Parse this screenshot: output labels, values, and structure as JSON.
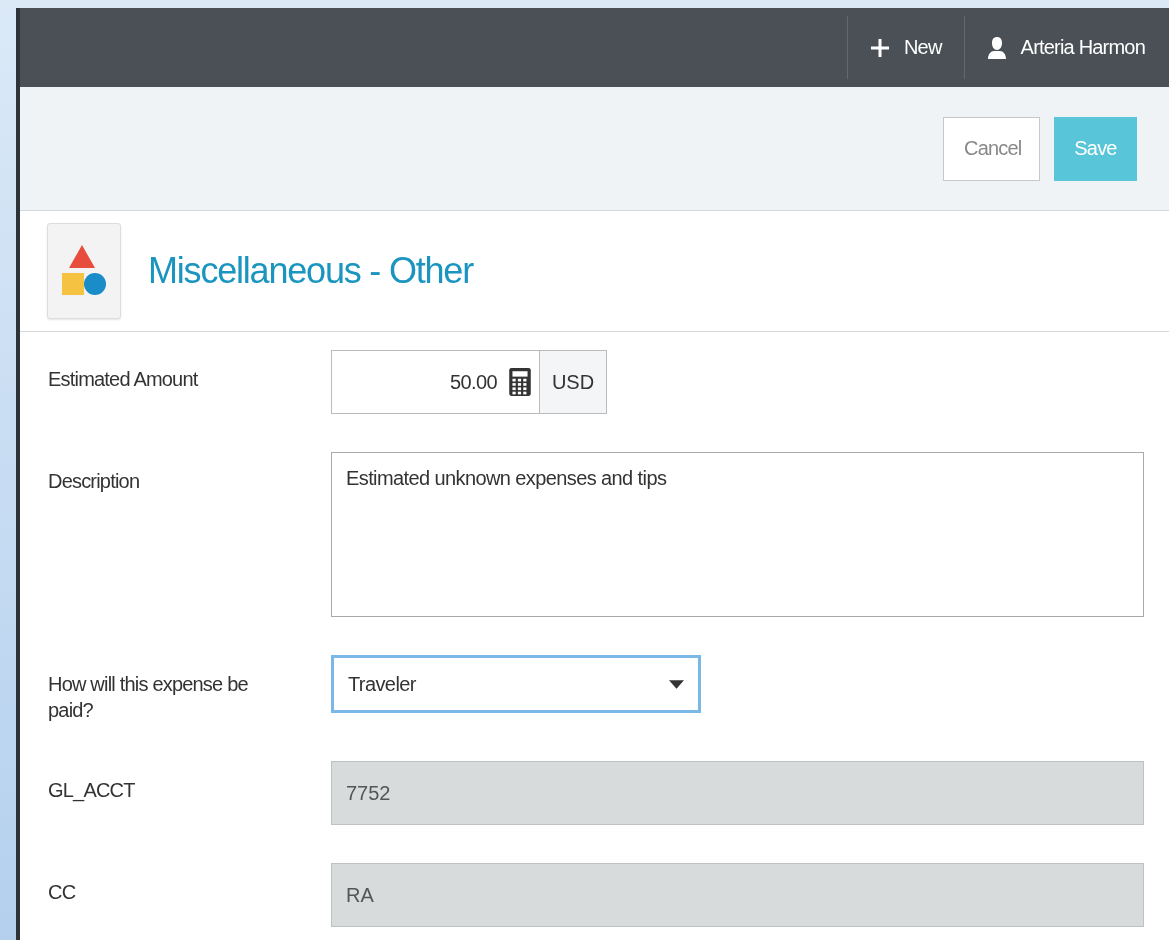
{
  "header": {
    "new_label": "New",
    "user_name": "Arteria Harmon"
  },
  "actions": [
    {
      "label": "Cancel",
      "kind": "secondary"
    },
    {
      "label": "Save",
      "kind": "primary"
    }
  ],
  "title": "Miscellaneous - Other",
  "fields": [
    {
      "kind": "amount",
      "label": "Estimated Amount",
      "value": "50.00",
      "currency": "USD"
    },
    {
      "kind": "textarea",
      "label": "Description",
      "value": "Estimated unknown expenses and tips"
    },
    {
      "kind": "select",
      "label": "How will this expense be paid?",
      "value": "Traveler",
      "focused": true
    },
    {
      "kind": "text",
      "label": "GL_ACCT",
      "value": "7752",
      "disabled": true
    },
    {
      "kind": "text",
      "label": "CC",
      "value": "RA",
      "disabled": true
    }
  ]
}
